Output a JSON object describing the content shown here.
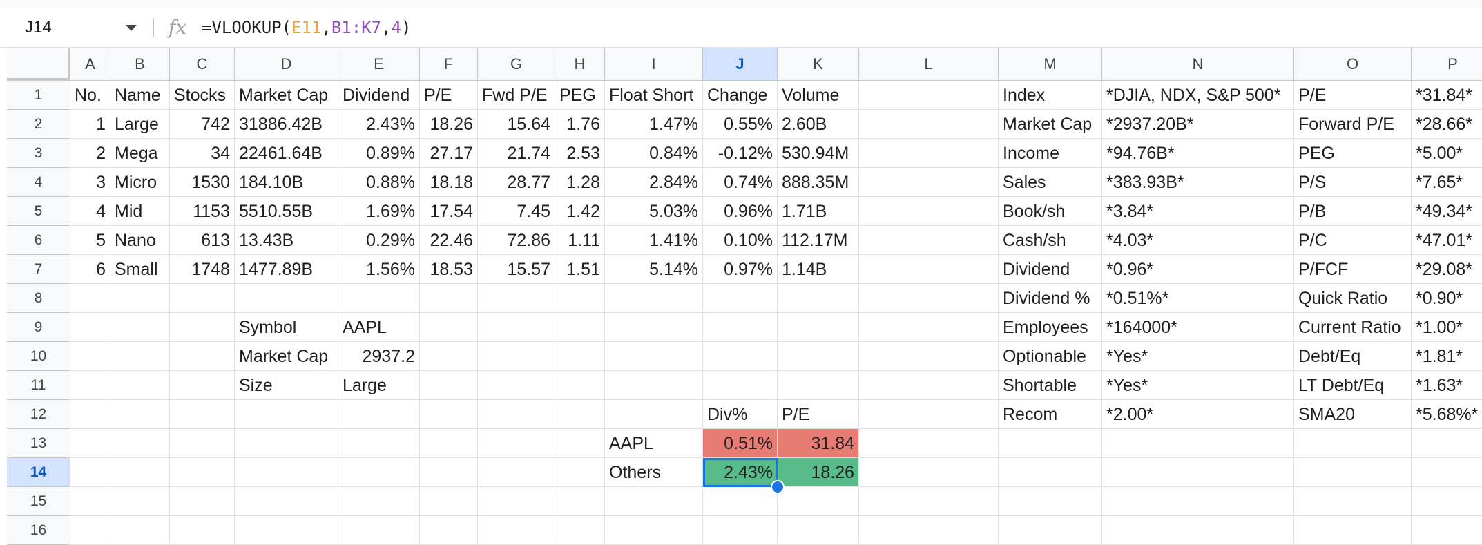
{
  "formula_bar": {
    "name_box": "J14",
    "fx_icon": "fx",
    "formula_parts": [
      {
        "text": "=VLOOKUP(",
        "color": "default"
      },
      {
        "text": "E11",
        "color": "orange"
      },
      {
        "text": ",",
        "color": "default"
      },
      {
        "text": "B1:K7",
        "color": "purple"
      },
      {
        "text": ",",
        "color": "default"
      },
      {
        "text": "4",
        "color": "purple"
      },
      {
        "text": ")",
        "color": "default"
      }
    ]
  },
  "colors": {
    "accent": "#1a73e8",
    "header_selected": "#d3e3fd",
    "red_fill": "#e67c73",
    "green_fill": "#57bb8a",
    "formula_ref_orange": "#e8a33d",
    "formula_ref_purple": "#8e4cb9"
  },
  "sheet": {
    "active_cell": "J14",
    "columns": [
      "A",
      "B",
      "C",
      "D",
      "E",
      "F",
      "G",
      "H",
      "I",
      "J",
      "K",
      "L",
      "M",
      "N",
      "O",
      "P"
    ],
    "rows": [
      "1",
      "2",
      "3",
      "4",
      "5",
      "6",
      "7",
      "8",
      "9",
      "10",
      "11",
      "12",
      "13",
      "14",
      "15",
      "16"
    ],
    "cells": {
      "A1": "No.",
      "B1": "Name",
      "C1": "Stocks",
      "D1": "Market Cap",
      "E1": "Dividend",
      "F1": "P/E",
      "G1": "Fwd P/E",
      "H1": "PEG",
      "I1": "Float Short",
      "J1": "Change",
      "K1": "Volume",
      "A2": "1",
      "B2": "Large",
      "C2": "742",
      "D2": "31886.42B",
      "E2": "2.43%",
      "F2": "18.26",
      "G2": "15.64",
      "H2": "1.76",
      "I2": "1.47%",
      "J2": "0.55%",
      "K2": "2.60B",
      "A3": "2",
      "B3": "Mega",
      "C3": "34",
      "D3": "22461.64B",
      "E3": "0.89%",
      "F3": "27.17",
      "G3": "21.74",
      "H3": "2.53",
      "I3": "0.84%",
      "J3": "-0.12%",
      "K3": "530.94M",
      "A4": "3",
      "B4": "Micro",
      "C4": "1530",
      "D4": "184.10B",
      "E4": "0.88%",
      "F4": "18.18",
      "G4": "28.77",
      "H4": "1.28",
      "I4": "2.84%",
      "J4": "0.74%",
      "K4": "888.35M",
      "A5": "4",
      "B5": "Mid",
      "C5": "1153",
      "D5": "5510.55B",
      "E5": "1.69%",
      "F5": "17.54",
      "G5": "7.45",
      "H5": "1.42",
      "I5": "5.03%",
      "J5": "0.96%",
      "K5": "1.71B",
      "A6": "5",
      "B6": "Nano",
      "C6": "613",
      "D6": "13.43B",
      "E6": "0.29%",
      "F6": "22.46",
      "G6": "72.86",
      "H6": "1.11",
      "I6": "1.41%",
      "J6": "0.10%",
      "K6": "112.17M",
      "A7": "6",
      "B7": "Small",
      "C7": "1748",
      "D7": "1477.89B",
      "E7": "1.56%",
      "F7": "18.53",
      "G7": "15.57",
      "H7": "1.51",
      "I7": "5.14%",
      "J7": "0.97%",
      "K7": "1.14B",
      "D9": "Symbol",
      "E9": "AAPL",
      "D10": "Market Cap",
      "E10": "2937.2",
      "D11": "Size",
      "E11": "Large",
      "J12": "Div%",
      "K12": "P/E",
      "I13": "AAPL",
      "J13": "0.51%",
      "K13": "31.84",
      "I14": "Others",
      "J14": "2.43%",
      "K14": "18.26",
      "M1": "Index",
      "N1": "*DJIA, NDX, S&P 500*",
      "O1": "P/E",
      "P1": "*31.84*",
      "M2": "Market Cap",
      "N2": "*2937.20B*",
      "O2": "Forward P/E",
      "P2": "*28.66*",
      "M3": "Income",
      "N3": "*94.76B*",
      "O3": "PEG",
      "P3": "*5.00*",
      "M4": "Sales",
      "N4": "*383.93B*",
      "O4": "P/S",
      "P4": "*7.65*",
      "M5": "Book/sh",
      "N5": "*3.84*",
      "O5": "P/B",
      "P5": "*49.34*",
      "M6": "Cash/sh",
      "N6": "*4.03*",
      "O6": "P/C",
      "P6": "*47.01*",
      "M7": "Dividend",
      "N7": "*0.96*",
      "O7": "P/FCF",
      "P7": "*29.08*",
      "M8": "Dividend %",
      "N8": "*0.51%*",
      "O8": "Quick Ratio",
      "P8": "*0.90*",
      "M9": "Employees",
      "N9": "*164000*",
      "O9": "Current Ratio",
      "P9": "*1.00*",
      "M10": "Optionable",
      "N10": "*Yes*",
      "O10": "Debt/Eq",
      "P10": "*1.81*",
      "M11": "Shortable",
      "N11": "*Yes*",
      "O11": "LT Debt/Eq",
      "P11": "*1.63*",
      "M12": "Recom",
      "N12": "*2.00*",
      "O12": "SMA20",
      "P12": "*5.68%*"
    }
  }
}
